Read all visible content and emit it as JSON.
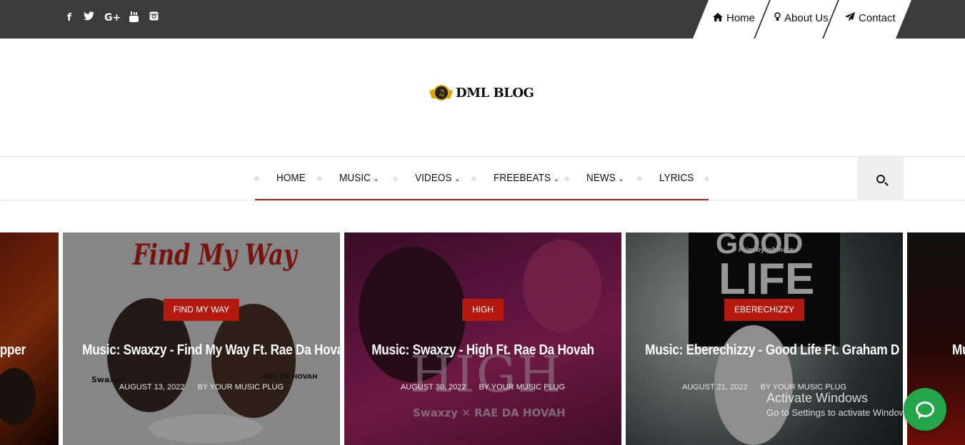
{
  "topbar": {
    "social_icons": [
      {
        "name": "facebook-icon",
        "glyph": "f"
      },
      {
        "name": "twitter-icon",
        "glyph": "🐦"
      },
      {
        "name": "google-plus-icon",
        "glyph": "G+"
      },
      {
        "name": "youtube-icon",
        "glyph": "▶"
      },
      {
        "name": "instagram-icon",
        "glyph": "◙"
      }
    ],
    "nav": [
      {
        "icon": "home-icon",
        "glyph": "⌂",
        "label": "Home"
      },
      {
        "icon": "lightbulb-icon",
        "glyph": "💡",
        "label": "About Us"
      },
      {
        "icon": "paper-plane-icon",
        "glyph": "✈",
        "label": "Contact"
      }
    ]
  },
  "logo": {
    "text": "DML BLOG",
    "badge_glyph": "♫"
  },
  "main_nav": {
    "items": [
      {
        "label": "HOME",
        "has_dropdown": false
      },
      {
        "label": "MUSIC",
        "has_dropdown": true
      },
      {
        "label": "VIDEOS",
        "has_dropdown": true
      },
      {
        "label": "FREEBEATS",
        "has_dropdown": true
      },
      {
        "label": "NEWS",
        "has_dropdown": true
      },
      {
        "label": "LYRICS",
        "has_dropdown": false
      }
    ],
    "chevron": "⌄",
    "search_icon": "search-icon",
    "accent": "#b3190f"
  },
  "slider": {
    "partial_left_title": "& Upper",
    "partial_right_title": "Mu",
    "cards": [
      {
        "category": "FIND MY WAY",
        "title": "Music: Swaxzy - Find My Way Ft. Rae Da Hovah",
        "date": "AUGUST 13, 2022",
        "author": "BY YOUR MUSIC PLUG",
        "art_headline": "Find My Way",
        "art_caption_left": "Swaxzy",
        "art_caption_right": "RAE DA HOVAH"
      },
      {
        "category": "HIGH",
        "title": "Music: Swaxzy - High Ft. Rae Da Hovah",
        "date": "AUGUST 30, 2022",
        "author": "BY YOUR MUSIC PLUG",
        "art_headline": "HIGH",
        "art_caption": "Swaxzy ✕ RAE DA HOVAH"
      },
      {
        "category": "EBERECHIZZY",
        "title": "Music: Eberechizzy - Good Life Ft. Graham D",
        "date": "AUGUST 21, 2022",
        "author": "BY YOUR MUSIC PLUG",
        "art_headline_1": "GOOD",
        "art_headline_2": "LIFE",
        "art_caption": "M/m by ohmixx"
      }
    ]
  },
  "windows_watermark": {
    "line1": "Activate Windows",
    "line2": "Go to Settings to activate Windows."
  },
  "chat_button": {
    "icon": "chat-icon",
    "color": "#25a54a"
  }
}
